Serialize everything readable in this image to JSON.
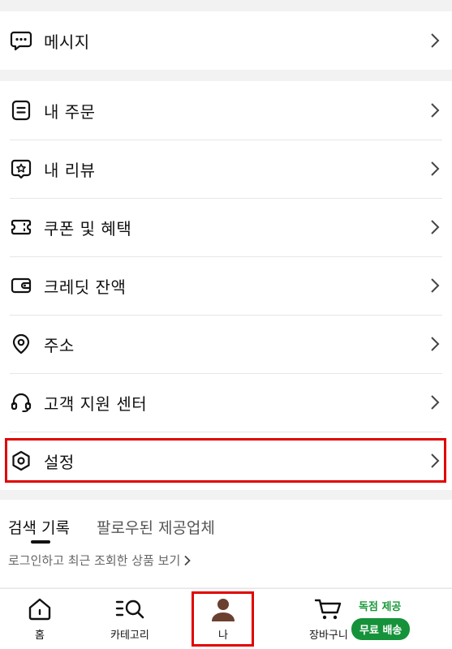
{
  "menu_top": [
    {
      "label": "메시지",
      "icon": "message-icon"
    }
  ],
  "menu_main": [
    {
      "label": "내 주문",
      "icon": "order-icon"
    },
    {
      "label": "내 리뷰",
      "icon": "review-icon"
    },
    {
      "label": "쿠폰 및 혜택",
      "icon": "coupon-icon"
    },
    {
      "label": "크레딧 잔액",
      "icon": "wallet-icon"
    },
    {
      "label": "주소",
      "icon": "location-icon"
    },
    {
      "label": "고객 지원 센터",
      "icon": "headset-icon"
    },
    {
      "label": "설정",
      "icon": "settings-icon"
    }
  ],
  "tabs": {
    "active": "검색 기록",
    "inactive": "팔로우된 제공업체",
    "login_hint": "로그인하고 최근 조회한 상품 보기"
  },
  "bottom_nav": {
    "home": "홈",
    "category": "카테고리",
    "me": "나",
    "cart": "장바구니",
    "promo_top": "독점 제공",
    "promo_badge": "무료 배송"
  },
  "colors": {
    "highlight": "#e10000",
    "promo_green": "#16923a",
    "avatar_brown": "#6b4030"
  }
}
